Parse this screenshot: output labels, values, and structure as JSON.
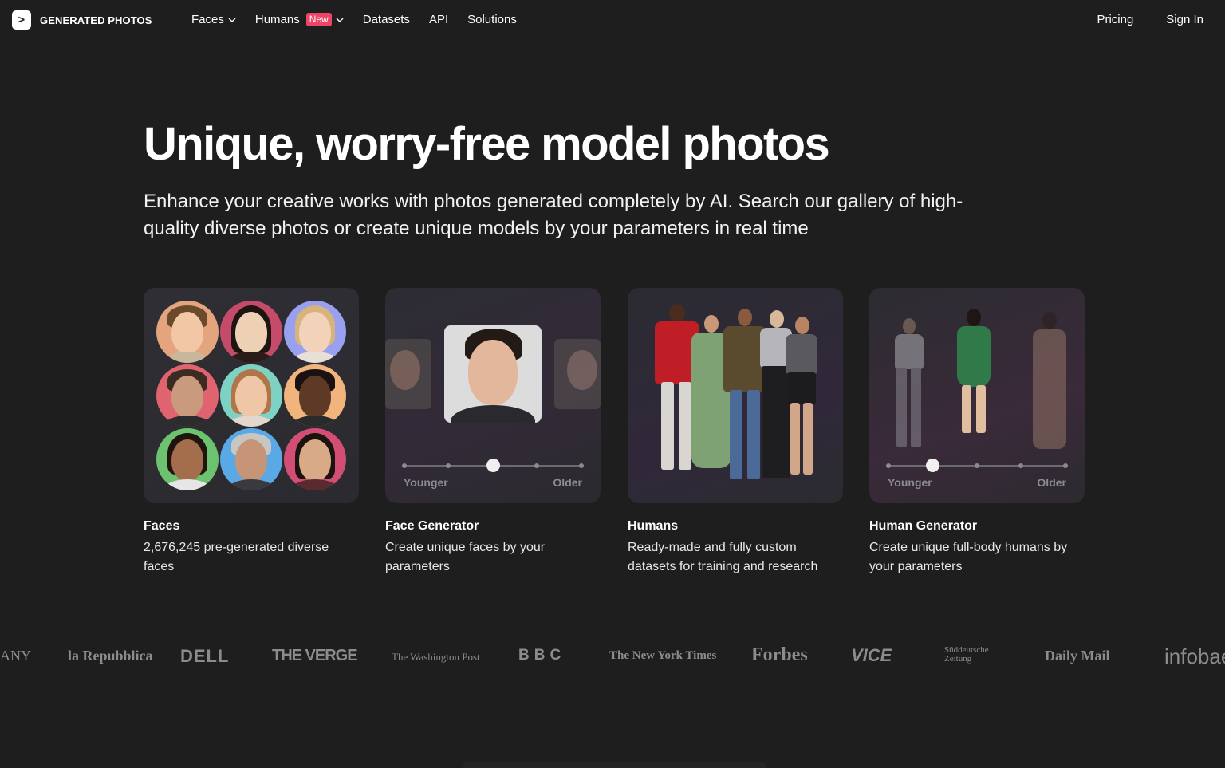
{
  "nav": {
    "logo_glyph": ">",
    "logo_text": "GENERATED PHOTOS",
    "links": [
      {
        "label": "Faces",
        "has_menu": true
      },
      {
        "label": "Humans",
        "badge": "New",
        "has_menu": true
      },
      {
        "label": "Datasets"
      },
      {
        "label": "API"
      },
      {
        "label": "Solutions"
      }
    ],
    "pricing_label": "Pricing",
    "signin_label": "Sign In"
  },
  "hero": {
    "title": "Unique, worry-free model photos",
    "subtitle": "Enhance your creative works with photos generated completely by AI. Search our gallery of high-quality diverse photos or create unique models by your parameters in real time"
  },
  "cards": [
    {
      "title": "Faces",
      "description": "2,676,245 pre-generated diverse faces"
    },
    {
      "title": "Face Generator",
      "description": "Create unique faces by your parameters",
      "slider_left": "Younger",
      "slider_right": "Older",
      "slider_value": 0.5
    },
    {
      "title": "Humans",
      "description": "Ready-made and fully custom datasets for training and research"
    },
    {
      "title": "Human Generator",
      "description": "Create unique full-body humans by your parameters",
      "slider_left": "Younger",
      "slider_right": "Older",
      "slider_value": 0.25
    }
  ],
  "press": [
    "ANY",
    "la Repubblica",
    "DELL",
    "THE VERGE",
    "The Washington Post",
    "BBC",
    "The New York Times",
    "Forbes",
    "VICE",
    "Süddeutsche Zeitung",
    "Daily Mail",
    "infobae"
  ],
  "colors": {
    "background": "#1e1e1e",
    "badge": "#ee4466",
    "press_text": "#8c8c8c"
  }
}
